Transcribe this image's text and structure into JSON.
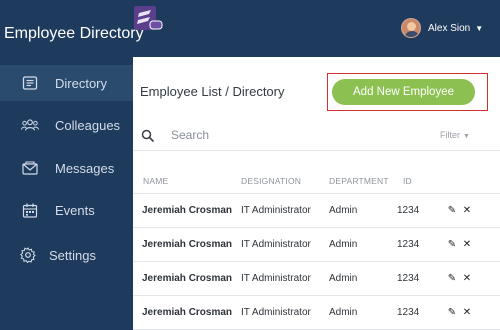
{
  "header": {
    "app_title": "Employee Directory",
    "user_name": "Alex Sion"
  },
  "sidebar": {
    "items": [
      {
        "label": "Directory",
        "icon": "address-book-icon",
        "active": true
      },
      {
        "label": "Colleagues",
        "icon": "people-icon",
        "active": false
      },
      {
        "label": "Messages",
        "icon": "envelope-icon",
        "active": false
      },
      {
        "label": "Events",
        "icon": "calendar-icon",
        "active": false
      },
      {
        "label": "Settings",
        "icon": "gear-icon",
        "active": false
      }
    ]
  },
  "main": {
    "title": "Employee List / Directory",
    "add_button_label": "Add New Employee",
    "search_placeholder": "Search",
    "filter_label": "Filter",
    "columns": [
      "NAME",
      "DESIGNATION",
      "DEPARTMENT",
      "ID"
    ],
    "rows": [
      {
        "name": "Jeremiah Crosman",
        "designation": "IT Administrator",
        "department": "Admin",
        "id": "1234"
      },
      {
        "name": "Jeremiah Crosman",
        "designation": "IT Administrator",
        "department": "Admin",
        "id": "1234"
      },
      {
        "name": "Jeremiah Crosman",
        "designation": "IT Administrator",
        "department": "Admin",
        "id": "1234"
      },
      {
        "name": "Jeremiah Crosman",
        "designation": "IT Administrator",
        "department": "Admin",
        "id": "1234"
      }
    ]
  },
  "colors": {
    "sidebar_bg": "#1e3a5c",
    "accent_green": "#8cc152",
    "highlight_red": "#d32f2f"
  }
}
